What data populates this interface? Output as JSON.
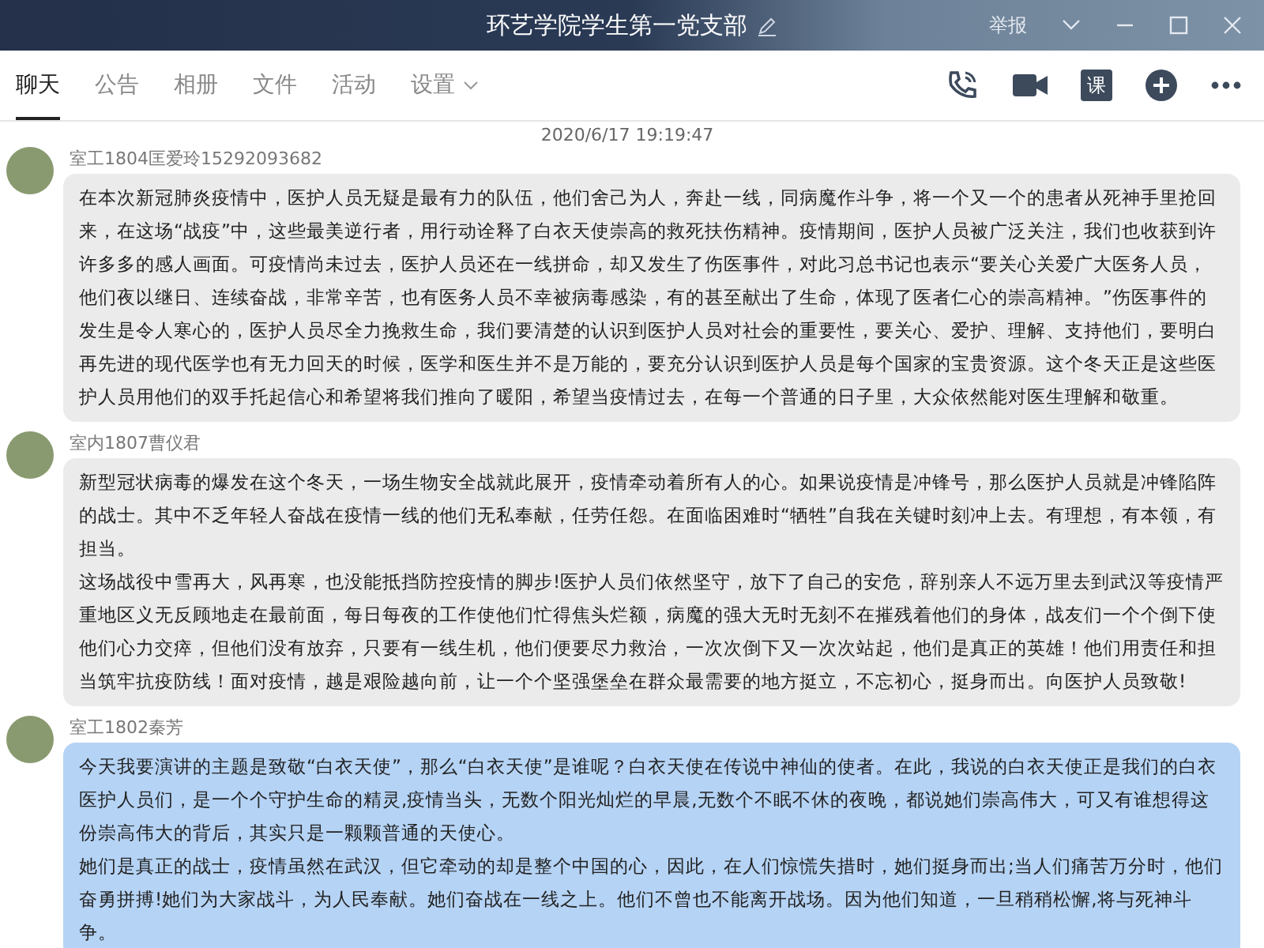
{
  "window": {
    "title": "环艺学院学生第一党支部",
    "report": "举报"
  },
  "tabs": [
    {
      "label": "聊天",
      "selected": true
    },
    {
      "label": "公告",
      "selected": false
    },
    {
      "label": "相册",
      "selected": false
    },
    {
      "label": "文件",
      "selected": false
    },
    {
      "label": "活动",
      "selected": false
    },
    {
      "label": "设置",
      "selected": false,
      "dropdown": true
    }
  ],
  "toolbar": {
    "course_label": "课"
  },
  "timestamp": "2020/6/17 19:19:47",
  "messages": [
    {
      "sender": "室工1804匡爱玲15292093682",
      "selected": false,
      "paragraphs": [
        "在本次新冠肺炎疫情中，医护人员无疑是最有力的队伍，他们舍己为人，奔赴一线，同病魔作斗争，将一个又一个的患者从死神手里抢回来，在这场“战疫”中，这些最美逆行者，用行动诠释了白衣天使崇高的救死扶伤精神。疫情期间，医护人员被广泛关注，我们也收获到许许多多的感人画面。可疫情尚未过去，医护人员还在一线拼命，却又发生了伤医事件，对此习总书记也表示“要关心关爱广大医务人员，他们夜以继日、连续奋战，非常辛苦，也有医务人员不幸被病毒感染，有的甚至献出了生命，体现了医者仁心的崇高精神。”伤医事件的发生是令人寒心的，医护人员尽全力挽救生命，我们要清楚的认识到医护人员对社会的重要性，要关心、爱护、理解、支持他们，要明白再先进的现代医学也有无力回天的时候，医学和医生并不是万能的，要充分认识到医护人员是每个国家的宝贵资源。这个冬天正是这些医护人员用他们的双手托起信心和希望将我们推向了暖阳，希望当疫情过去，在每一个普通的日子里，大众依然能对医生理解和敬重。"
      ]
    },
    {
      "sender": "室内1807曹仪君",
      "selected": false,
      "paragraphs": [
        "新型冠状病毒的爆发在这个冬天，一场生物安全战就此展开，疫情牵动着所有人的心。如果说疫情是冲锋号，那么医护人员就是冲锋陷阵的战士。其中不乏年轻人奋战在疫情一线的他们无私奉献，任劳任怨。在面临困难时“牺牲”自我在关键时刻冲上去。有理想，有本领，有担当。",
        "这场战役中雪再大，风再寒，也没能抵挡防控疫情的脚步!医护人员们依然坚守，放下了自己的安危，辞别亲人不远万里去到武汉等疫情严重地区义无反顾地走在最前面，每日每夜的工作使他们忙得焦头烂额，病魔的强大无时无刻不在摧残着他们的身体，战友们一个个倒下使他们心力交瘁，但他们没有放弃，只要有一线生机，他们便要尽力救治，一次次倒下又一次次站起，他们是真正的英雄！他们用责任和担当筑牢抗疫防线！面对疫情，越是艰险越向前，让一个个坚强堡垒在群众最需要的地方挺立，不忘初心，挺身而出。向医护人员致敬!"
      ]
    },
    {
      "sender": "室工1802秦芳",
      "selected": true,
      "paragraphs": [
        "今天我要演讲的主题是致敬“白衣天使”，那么“白衣天使”是谁呢？白衣天使在传说中神仙的使者。在此，我说的白衣天使正是我们的白衣医护人员们，是一个个守护生命的精灵,疫情当头，无数个阳光灿烂的早晨,无数个不眠不休的夜晚，都说她们崇高伟大，可又有谁想得这份崇高伟大的背后，其实只是一颗颗普通的天使心。",
        "她们是真正的战士，疫情虽然在武汉，但它牵动的却是整个中国的心，因此，在人们惊慌失措时，她们挺身而出;当人们痛苦万分时，他们奋勇拼搏!她们为大家战斗，为人民奉献。她们奋战在一线之上。他们不曾也不能离开战场。因为他们知道，一旦稍稍松懈,将与死神斗争。"
      ]
    }
  ]
}
